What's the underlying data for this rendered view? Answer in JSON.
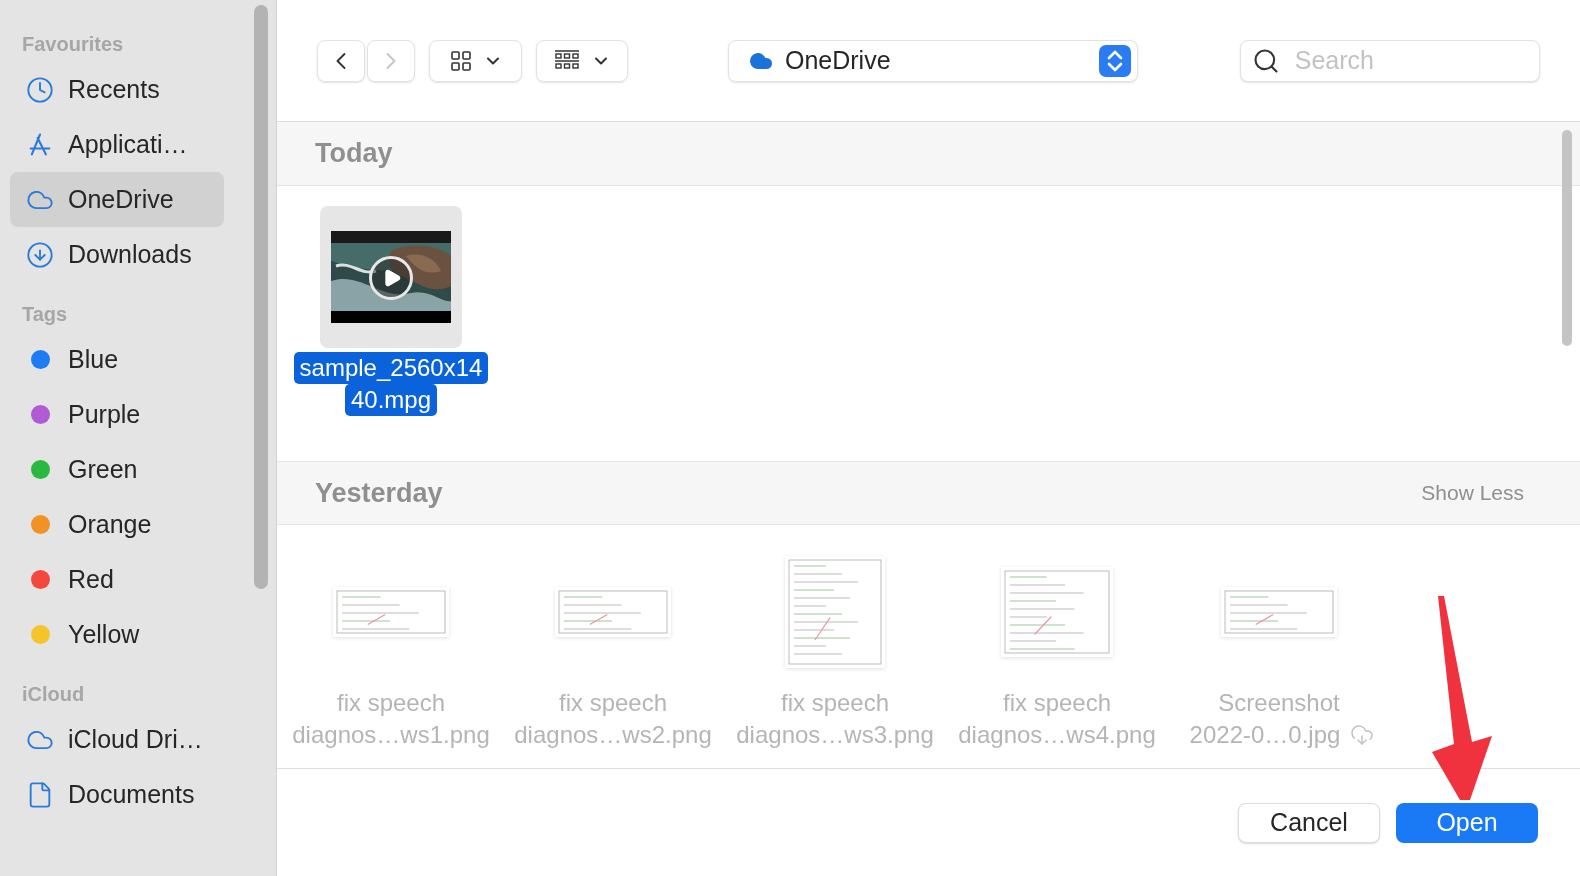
{
  "sidebar": {
    "sections": [
      {
        "title": "Favourites",
        "items": [
          {
            "label": "Recents",
            "kind": "clock",
            "selected": false
          },
          {
            "label": "Applicati…",
            "kind": "apps",
            "selected": false
          },
          {
            "label": "OneDrive",
            "kind": "cloud",
            "selected": true
          },
          {
            "label": "Downloads",
            "kind": "download",
            "selected": false
          }
        ]
      },
      {
        "title": "Tags",
        "items": [
          {
            "label": "Blue",
            "kind": "tag",
            "color": "#1e7cf2",
            "selected": false
          },
          {
            "label": "Purple",
            "kind": "tag",
            "color": "#b05ad6",
            "selected": false
          },
          {
            "label": "Green",
            "kind": "tag",
            "color": "#2ab940",
            "selected": false
          },
          {
            "label": "Orange",
            "kind": "tag",
            "color": "#f29226",
            "selected": false
          },
          {
            "label": "Red",
            "kind": "tag",
            "color": "#f5473e",
            "selected": false
          },
          {
            "label": "Yellow",
            "kind": "tag",
            "color": "#f4c42a",
            "selected": false
          }
        ]
      },
      {
        "title": "iCloud",
        "items": [
          {
            "label": "iCloud Dri…",
            "kind": "cloud",
            "selected": false
          },
          {
            "label": "Documents",
            "kind": "document",
            "selected": false
          }
        ]
      }
    ]
  },
  "toolbar": {
    "location": "OneDrive",
    "search": {
      "placeholder": "Search"
    },
    "back_disabled": false,
    "forward_disabled": true
  },
  "groups": [
    {
      "title": "Today",
      "items": [
        {
          "kind": "video",
          "name_lines": [
            "sample_2560x14",
            "40.mpg"
          ],
          "selected": true,
          "disabled": false,
          "in_cloud": false
        }
      ]
    },
    {
      "title": "Yesterday",
      "action": "Show Less",
      "items": [
        {
          "kind": "wide",
          "name_lines": [
            "fix speech",
            "diagnos…ws1.png"
          ],
          "selected": false,
          "disabled": true,
          "in_cloud": false
        },
        {
          "kind": "wide",
          "name_lines": [
            "fix speech",
            "diagnos…ws2.png"
          ],
          "selected": false,
          "disabled": true,
          "in_cloud": false
        },
        {
          "kind": "tall",
          "name_lines": [
            "fix speech",
            "diagnos…ws3.png"
          ],
          "selected": false,
          "disabled": true,
          "in_cloud": false
        },
        {
          "kind": "square",
          "name_lines": [
            "fix speech",
            "diagnos…ws4.png"
          ],
          "selected": false,
          "disabled": true,
          "in_cloud": false
        },
        {
          "kind": "wide",
          "name_lines": [
            "Screenshot",
            "2022-0…0.jpg"
          ],
          "selected": false,
          "disabled": true,
          "in_cloud": true
        }
      ]
    }
  ],
  "buttons": [
    {
      "label": "Cancel",
      "primary": false
    },
    {
      "label": "Open",
      "primary": true
    }
  ]
}
